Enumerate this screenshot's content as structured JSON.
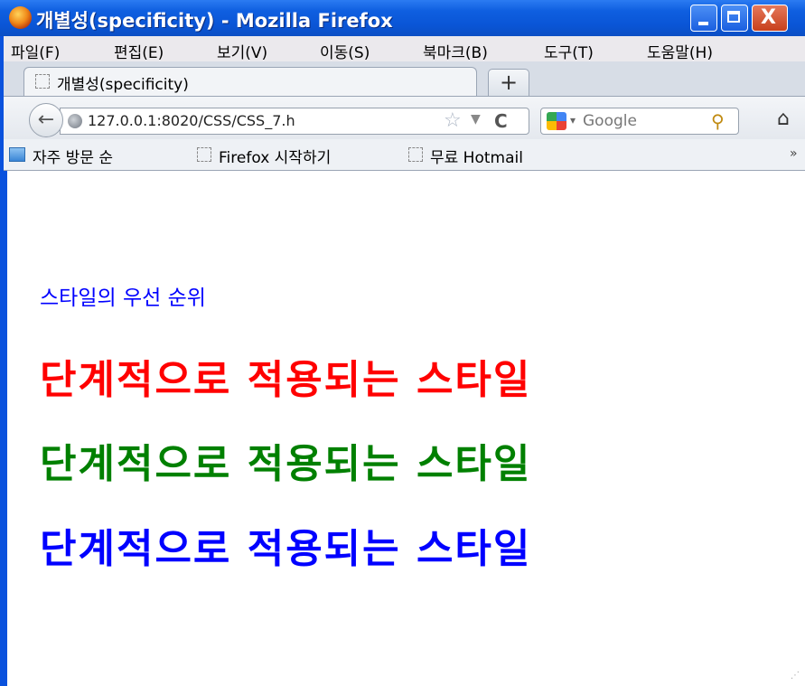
{
  "window": {
    "title": "개별성(specificity) - Mozilla Firefox",
    "close_glyph": "X"
  },
  "menu": [
    "파일(F)",
    "편집(E)",
    "보기(V)",
    "이동(S)",
    "북마크(B)",
    "도구(T)",
    "도움말(H)"
  ],
  "tab": {
    "title": "개별성(specificity)",
    "new_tab_glyph": "+"
  },
  "nav": {
    "url": "127.0.0.1:8020/CSS/CSS_7.h",
    "search_placeholder": "Google"
  },
  "bookmarks": [
    "자주 방문 순",
    "Firefox 시작하기",
    "무료 Hotmail"
  ],
  "page": {
    "heading": "스타일의 우선 순위",
    "lines": [
      {
        "text": "단계적으로 적용되는 스타일",
        "color": "#ff0000"
      },
      {
        "text": "단계적으로 적용되는 스타일",
        "color": "#008000"
      },
      {
        "text": "단계적으로 적용되는 스타일",
        "color": "#0000ff"
      }
    ]
  }
}
